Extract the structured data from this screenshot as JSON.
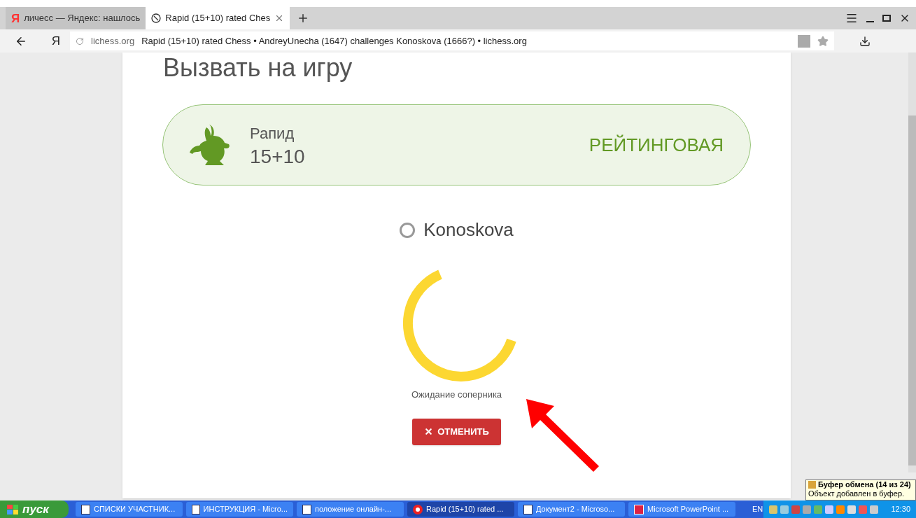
{
  "browser": {
    "tabs": [
      {
        "title": "личесс — Яндекс: нашлось",
        "selected": false,
        "kind": "yandex",
        "logo": "Я"
      },
      {
        "title": "Rapid (15+10) rated Ches",
        "selected": true,
        "kind": "lichess"
      }
    ],
    "home_button": "Я",
    "address": {
      "domain": "lichess.org",
      "title": "Rapid (15+10) rated Chess • AndreyUnecha (1647) challenges Konoskova (1666?) • lichess.org"
    }
  },
  "page": {
    "heading": "Вызвать на игру",
    "game": {
      "type": "Рапид",
      "time": "15+10",
      "mode": "РЕЙТИНГОВАЯ"
    },
    "opponent": {
      "name": "Konoskova",
      "online": false
    },
    "status": "Ожидание соперника",
    "cancel_button": "ОТМЕНИТЬ"
  },
  "taskbar": {
    "start": "пуск",
    "items": [
      {
        "label": "СПИСКИ  УЧАСТНИК...",
        "selected": false,
        "kind": "word"
      },
      {
        "label": "ИНСТРУКЦИЯ - Micro...",
        "selected": false,
        "kind": "word"
      },
      {
        "label": "положение онлайн-...",
        "selected": false,
        "kind": "word"
      },
      {
        "label": "Rapid (15+10) rated ...",
        "selected": true,
        "kind": "browser"
      },
      {
        "label": "Документ2 - Microso...",
        "selected": false,
        "kind": "word"
      },
      {
        "label": "Microsoft PowerPoint ...",
        "selected": false,
        "kind": "powerpoint"
      }
    ],
    "language": "EN",
    "clock": "12:30"
  },
  "notification": {
    "title": "Буфер обмена (14 из 24)",
    "body": "Объект добавлен в буфер."
  }
}
